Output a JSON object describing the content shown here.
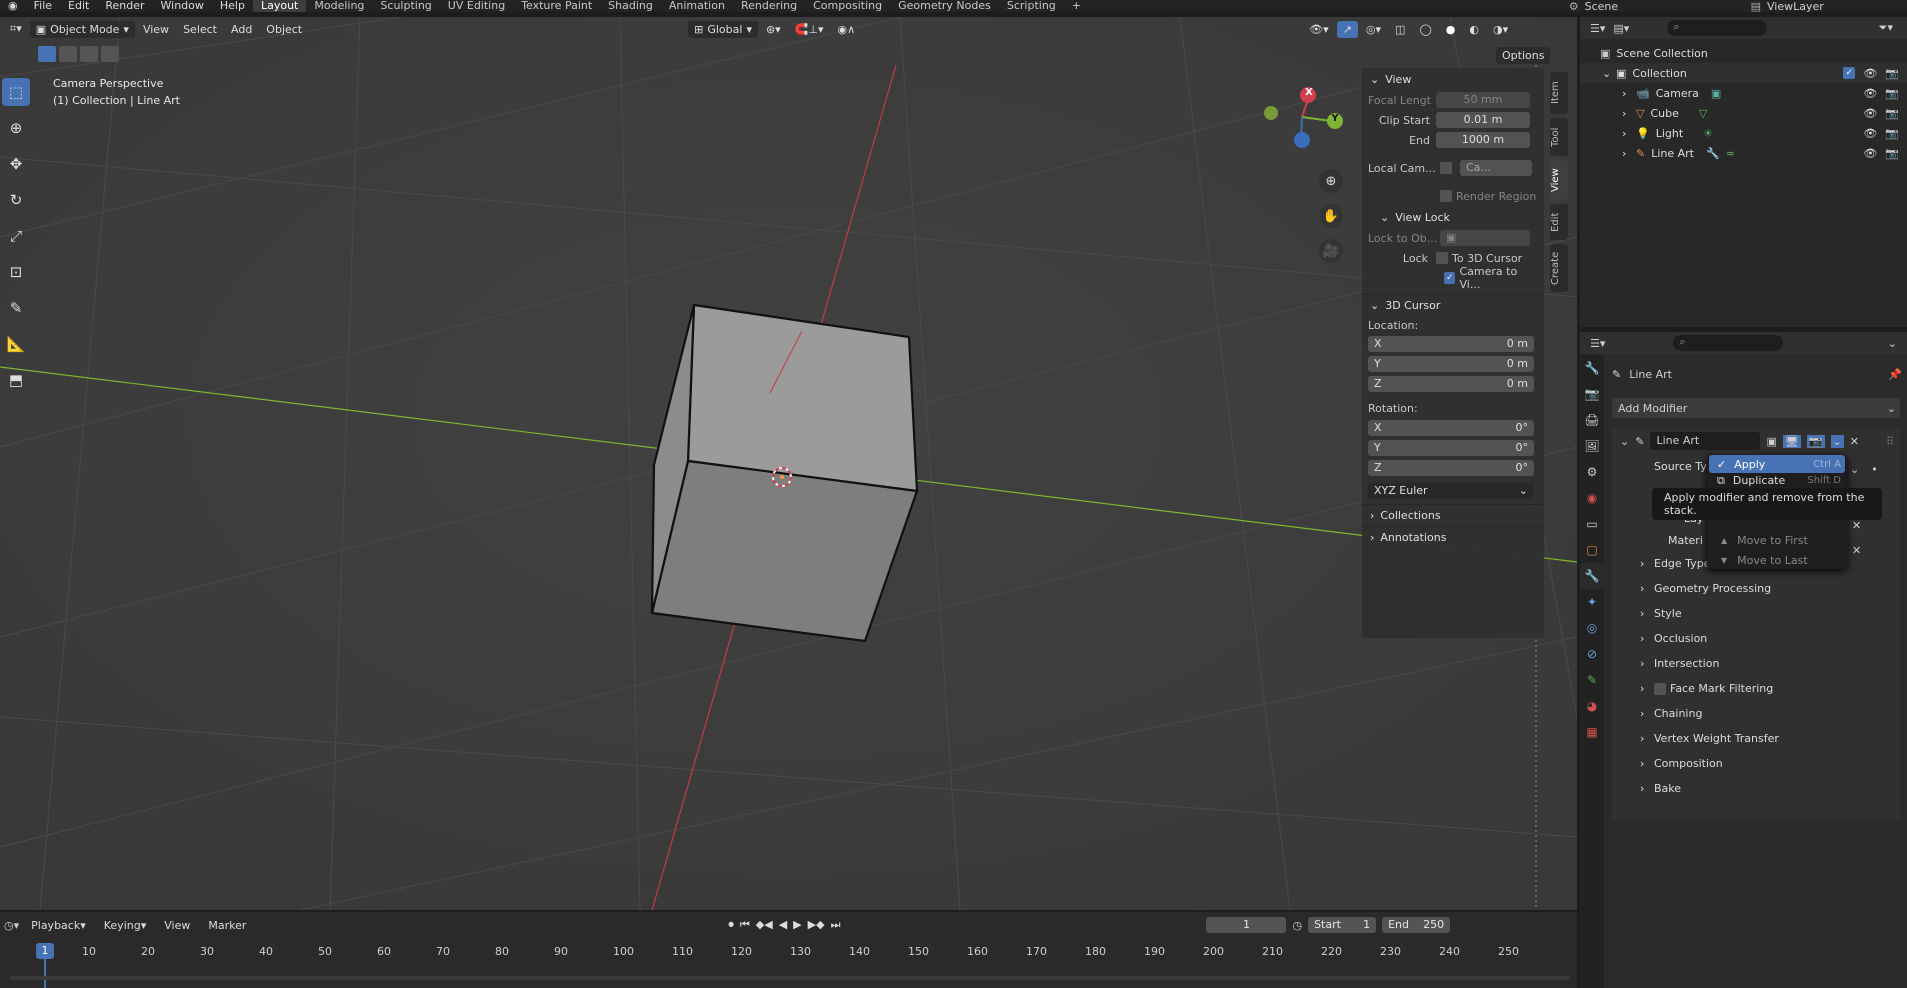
{
  "menu": {
    "blender_icon": "blender-logo-icon",
    "file": "File",
    "edit": "Edit",
    "render": "Render",
    "window": "Window",
    "help": "Help"
  },
  "workspaces": [
    "Layout",
    "Modeling",
    "Sculpting",
    "UV Editing",
    "Texture Paint",
    "Shading",
    "Animation",
    "Rendering",
    "Compositing",
    "Geometry Nodes",
    "Scripting"
  ],
  "add_workspace": "+",
  "scene": {
    "name": "Scene",
    "view_layer": "ViewLayer"
  },
  "viewport_header": {
    "mode": "Object Mode",
    "view": "View",
    "select": "Select",
    "add": "Add",
    "object": "Object",
    "transform": "Global",
    "options": "Options"
  },
  "viewport": {
    "camera_label": "Camera Perspective",
    "collection_label": "(1) Collection | Line Art"
  },
  "gizmo": {
    "x": "X",
    "y": "Y"
  },
  "npanel": {
    "view_section": "View",
    "focal_label": "Focal Lengt",
    "focal_value": "50 mm",
    "clip_start_label": "Clip Start",
    "clip_start_value": "0.01 m",
    "end_label": "End",
    "end_value": "1000 m",
    "local_cam_label": "Local Cam...",
    "local_cam_value": "Ca...",
    "render_region": "Render Region",
    "view_lock_section": "View Lock",
    "lock_to_obj_label": "Lock to Ob...",
    "lock_label": "Lock",
    "to_3d_cursor": "To 3D Cursor",
    "camera_to_view": "Camera to Vi...",
    "cursor_section": "3D Cursor",
    "location_label": "Location:",
    "loc": [
      {
        "axis": "X",
        "value": "0 m"
      },
      {
        "axis": "Y",
        "value": "0 m"
      },
      {
        "axis": "Z",
        "value": "0 m"
      }
    ],
    "rotation_label": "Rotation:",
    "rot": [
      {
        "axis": "X",
        "value": "0°"
      },
      {
        "axis": "Y",
        "value": "0°"
      },
      {
        "axis": "Z",
        "value": "0°"
      }
    ],
    "rot_mode": "XYZ Euler",
    "collections_section": "Collections",
    "annotations_section": "Annotations"
  },
  "vtabs": [
    "Item",
    "Tool",
    "View",
    "Edit",
    "Create"
  ],
  "outliner": {
    "scene_collection": "Scene Collection",
    "collection": "Collection",
    "items": [
      "Camera",
      "Cube",
      "Light",
      "Line Art"
    ]
  },
  "properties": {
    "object_name": "Line Art",
    "add_modifier": "Add Modifier",
    "modifier_name": "Line Art",
    "source_type": "Source Typ",
    "layer": "Lay",
    "material": "Materi",
    "sections": [
      "Edge Types",
      "Geometry Processing",
      "Style",
      "Occlusion",
      "Intersection",
      "Face Mark Filtering",
      "Chaining",
      "Vertex Weight Transfer",
      "Composition",
      "Bake"
    ]
  },
  "context_menu": {
    "apply": "Apply",
    "apply_shortcut": "Ctrl A",
    "duplicate": "Duplicate",
    "duplicate_shortcut": "Shift D",
    "move_first": "Move to First",
    "move_last": "Move to Last"
  },
  "tooltip": "Apply modifier and remove from the stack.",
  "timeline": {
    "playback": "Playback",
    "keying": "Keying",
    "view": "View",
    "marker": "Marker",
    "current_frame": "1",
    "start_label": "Start",
    "start_value": "1",
    "end_label": "End",
    "end_value": "250",
    "ruler": [
      "1",
      "10",
      "20",
      "30",
      "40",
      "50",
      "60",
      "70",
      "80",
      "90",
      "100",
      "110",
      "120",
      "130",
      "140",
      "150",
      "160",
      "170",
      "180",
      "190",
      "200",
      "210",
      "220",
      "230",
      "240",
      "250"
    ]
  },
  "colors": {
    "accent": "#4772b3",
    "x_axis": "#d23e4c",
    "y_axis": "#7fb532",
    "z_axis": "#3b6dbd"
  }
}
